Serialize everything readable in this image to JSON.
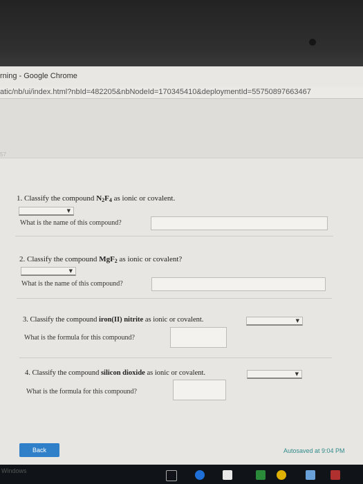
{
  "window": {
    "title": "rning - Google Chrome",
    "url": "atic/nb/ui/index.html?nbId=482205&nbNodeId=170345410&deploymentId=55750897663467"
  },
  "header": {
    "faint_text": "57"
  },
  "questions": [
    {
      "number": "1.",
      "prompt_pre": "Classify the compound ",
      "compound_main": "N",
      "compound_sub1": "2",
      "compound_mid": "F",
      "compound_sub2": "4",
      "prompt_post": " as ionic or covalent.",
      "name_label": "What is the name of this compound?"
    },
    {
      "number": "2.",
      "prompt_pre": "Classify the compound ",
      "compound_main": "MgF",
      "compound_sub1": "2",
      "prompt_post": " as ionic or covalent?",
      "name_label": "What is the name of this compound?"
    },
    {
      "number": "3.",
      "prompt_pre": "Classify the compound ",
      "compound_bold": "iron(II) nitrite",
      "prompt_post": " as ionic or covalent.",
      "formula_label": "What is the formula for this compound?"
    },
    {
      "number": "4.",
      "prompt_pre": "Classify the compound ",
      "compound_bold": "silicon dioxide",
      "prompt_post": " as ionic or covalent.",
      "formula_label": "What is the formula for this compound?"
    }
  ],
  "footer": {
    "back_label": "Back",
    "autosave": "Autosaved at 9:04 PM"
  },
  "taskbar": {
    "watermark": "Windows"
  },
  "icons": {
    "dropdown": "chevron-down-icon"
  }
}
